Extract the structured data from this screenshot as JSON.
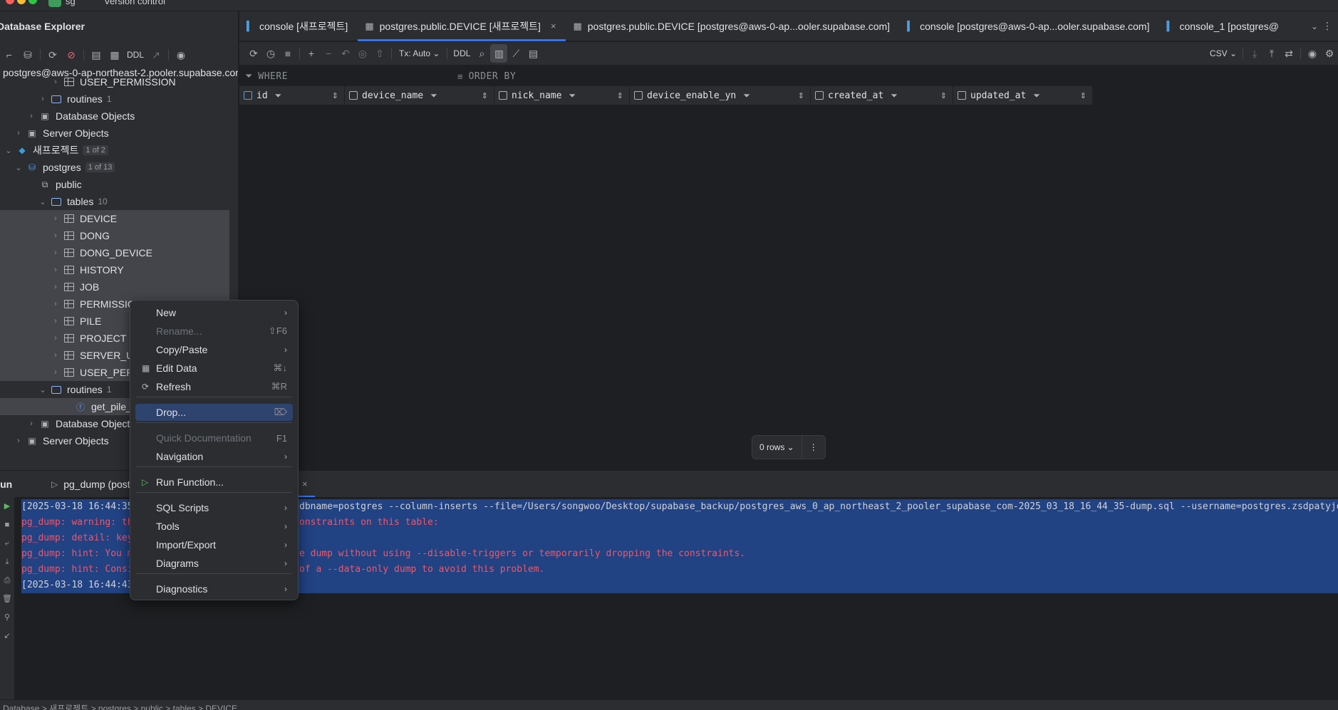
{
  "titlebar": {
    "project_label": "sg",
    "vcs_label": "Version control"
  },
  "explorer": {
    "title": "Database Explorer",
    "toolbar_ddl": "DDL",
    "connection": "postgres@aws-0-ap-northeast-2.pooler.supabase.com",
    "rows": [
      {
        "label": "USER_PERMISSION",
        "type": "table"
      },
      {
        "label": "routines",
        "count": "1",
        "type": "folder"
      },
      {
        "label": "Database Objects",
        "type": "dbobj"
      },
      {
        "label": "Server Objects",
        "type": "server"
      },
      {
        "label": "새프로젝트",
        "badge": "1 of 2",
        "type": "datasource"
      },
      {
        "label": "postgres",
        "badge": "1 of 13",
        "type": "database"
      },
      {
        "label": "public",
        "type": "schema"
      },
      {
        "label": "tables",
        "count": "10",
        "type": "folder"
      },
      {
        "label": "DEVICE",
        "type": "table"
      },
      {
        "label": "DONG",
        "type": "table"
      },
      {
        "label": "DONG_DEVICE",
        "type": "table"
      },
      {
        "label": "HISTORY",
        "type": "table"
      },
      {
        "label": "JOB",
        "type": "table"
      },
      {
        "label": "PERMISSIO",
        "type": "table"
      },
      {
        "label": "PILE",
        "type": "table"
      },
      {
        "label": "PROJECT",
        "type": "table"
      },
      {
        "label": "SERVER_US",
        "type": "table"
      },
      {
        "label": "USER_PERM",
        "type": "table"
      },
      {
        "label": "routines",
        "count": "1",
        "type": "folder"
      },
      {
        "label": "get_pile_da",
        "type": "function"
      },
      {
        "label": "Database Objects",
        "type": "dbobj"
      },
      {
        "label": "Server Objects",
        "type": "server"
      }
    ]
  },
  "tabs": [
    {
      "label": "console [새프로젝트]"
    },
    {
      "label": "postgres.public.DEVICE [새프로젝트]"
    },
    {
      "label": "postgres.public.DEVICE [postgres@aws-0-ap...ooler.supabase.com]"
    },
    {
      "label": "console [postgres@aws-0-ap...ooler.supabase.com]"
    },
    {
      "label": "console_1 [postgres@"
    }
  ],
  "data_toolbar": {
    "tx_mode": "Tx: Auto",
    "ddl": "DDL",
    "export_format": "CSV"
  },
  "filter": {
    "where": "WHERE",
    "order_by": "ORDER BY"
  },
  "columns": [
    "id",
    "device_name",
    "nick_name",
    "device_enable_yn",
    "created_at",
    "updated_at"
  ],
  "result": {
    "rows_label": "0 rows"
  },
  "run_panel": {
    "label": "Run",
    "tab_label": "pg_dump (postgres",
    "lines": [
      {
        "text": "[2025-03-18 16:44:35",
        "kind": "norm"
      },
      {
        "text": "pg_dump: warning: th",
        "kind": "err"
      },
      {
        "text": "pg_dump: detail: key",
        "kind": "err"
      },
      {
        "text": "pg_dump: hint: You m",
        "kind": "err"
      },
      {
        "text": "pg_dump: hint: Consi",
        "kind": "err"
      },
      {
        "text": "[2025-03-18 16:44:43",
        "kind": "norm"
      }
    ],
    "tails": [
      {
        "text": "dbname=postgres --column-inserts --file=/Users/songwoo/Desktop/supabase_backup/postgres_aws_0_ap_northeast_2_pooler_supabase_com-2025_03_18_16_44_35-dump.sql --username=postgres.zsdpatyjo",
        "kind": "norm"
      },
      {
        "text": "onstraints on this table:",
        "kind": "err"
      },
      {
        "text": "",
        "kind": "err"
      },
      {
        "text": "e dump without using --disable-triggers or temporarily dropping the constraints.",
        "kind": "err"
      },
      {
        "text": "of a --data-only dump to avoid this problem.",
        "kind": "err"
      },
      {
        "text": "",
        "kind": "norm"
      }
    ]
  },
  "statusbar": {
    "crumbs": "Database > 새프로젝트 > postgres > public > tables > DEVICE"
  },
  "context_menu": {
    "items": [
      {
        "label": "New",
        "submenu": true
      },
      {
        "label": "Rename...",
        "shortcut": "⇧F6",
        "disabled": true
      },
      {
        "label": "Copy/Paste",
        "submenu": true
      },
      {
        "label": "Edit Data",
        "shortcut": "⌘↓",
        "icon": "table-icon"
      },
      {
        "label": "Refresh",
        "shortcut": "⌘R",
        "icon": "refresh-icon"
      },
      {
        "label": "Drop...",
        "shortcut": "⌦",
        "highlighted": true
      },
      {
        "label": "Quick Documentation",
        "shortcut": "F1",
        "disabled": true
      },
      {
        "label": "Navigation",
        "submenu": true
      },
      {
        "label": "Run Function...",
        "icon": "run-icon"
      },
      {
        "label": "SQL Scripts",
        "submenu": true
      },
      {
        "label": "Tools",
        "submenu": true
      },
      {
        "label": "Import/Export",
        "submenu": true
      },
      {
        "label": "Diagrams",
        "submenu": true
      },
      {
        "label": "Diagnostics",
        "submenu": true
      }
    ]
  },
  "colors": {
    "accent": "#3574f0",
    "selection": "#214283",
    "error": "#f75464",
    "menu_highlight": "#2e436e"
  }
}
